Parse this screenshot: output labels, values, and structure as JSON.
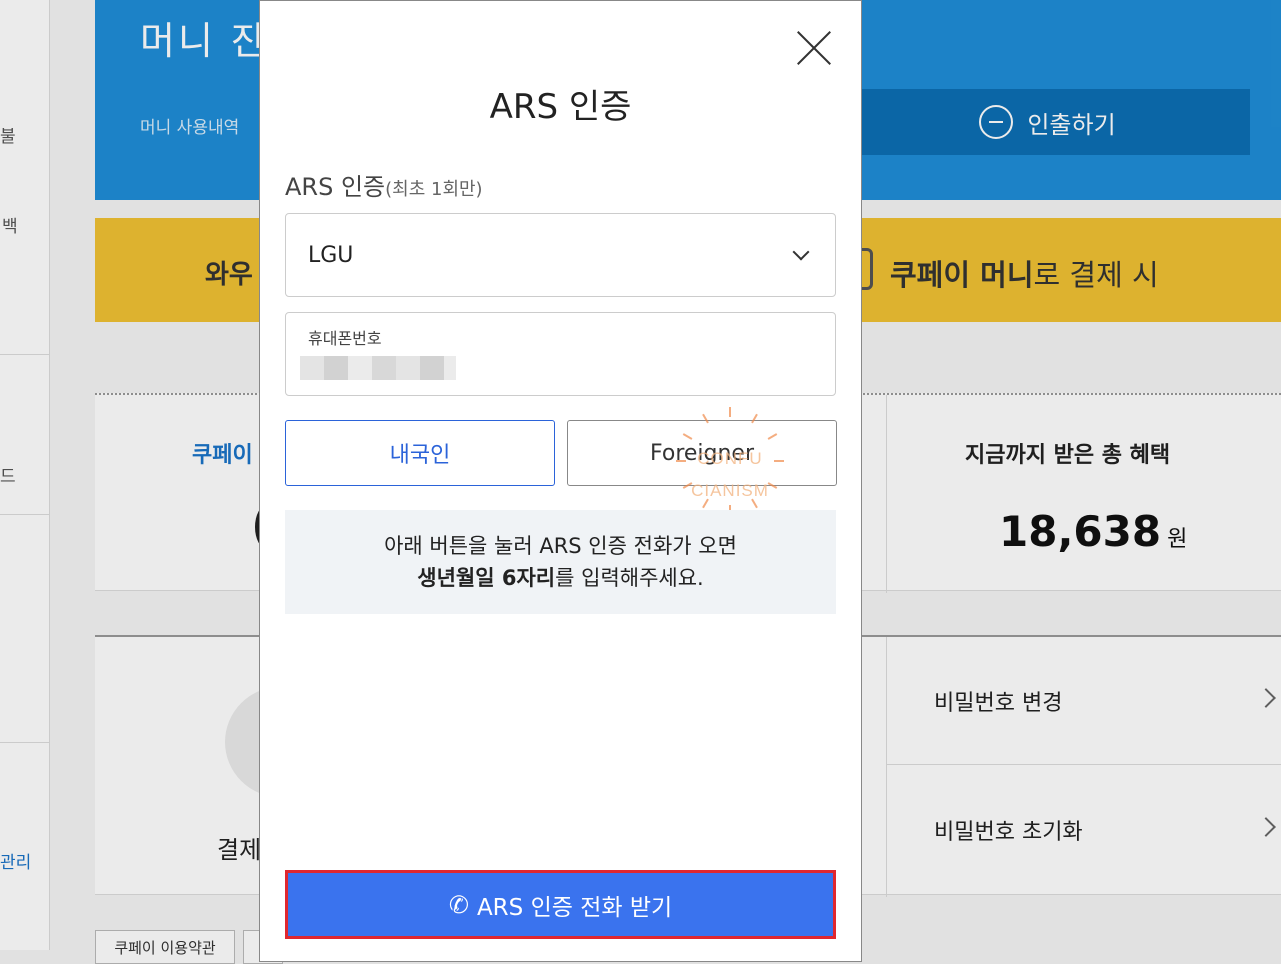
{
  "background": {
    "nav": [
      "불",
      "백",
      "드",
      "관리"
    ],
    "hero": {
      "balance_label": "머니 잔",
      "history_link": "머니 사용내역",
      "withdraw_label": "인출하기"
    },
    "banner": {
      "wow_text": "와우",
      "promo_bold": "쿠페이 머니",
      "promo_rest": "로 결제 시"
    },
    "stats": {
      "coupay_label": "쿠페이",
      "benefit_title": "지금까지 받은 총 혜택",
      "benefit_value": "18,638",
      "benefit_unit": "원"
    },
    "settings": {
      "pay_label": "결제",
      "password_change": "비밀번호 변경",
      "password_reset": "비밀번호 초기화"
    },
    "footer": {
      "terms": "쿠페이 이용약관"
    }
  },
  "modal": {
    "title": "ARS 인증",
    "field_label": "ARS 인증",
    "field_label_sub": "(최초 1회만)",
    "carrier_value": "LGU",
    "phone_label": "휴대폰번호",
    "domestic_label": "내국인",
    "foreigner_label": "Foreigner",
    "info_line1": "아래 버튼을 눌러 ARS 인증 전화가 오면",
    "info_line2_bold": "생년월일 6자리",
    "info_line2_rest": "를 입력해주세요.",
    "call_button": "ARS 인증 전화 받기",
    "call_icon": "phone-icon"
  },
  "watermark": {
    "line1": "CONFU",
    "line2": "CIANISM"
  },
  "colors": {
    "accent": "#3a73ee",
    "highlight_border": "#e0272f",
    "hero_blue": "#1f8ed8",
    "banner_yellow": "#f0c233"
  }
}
